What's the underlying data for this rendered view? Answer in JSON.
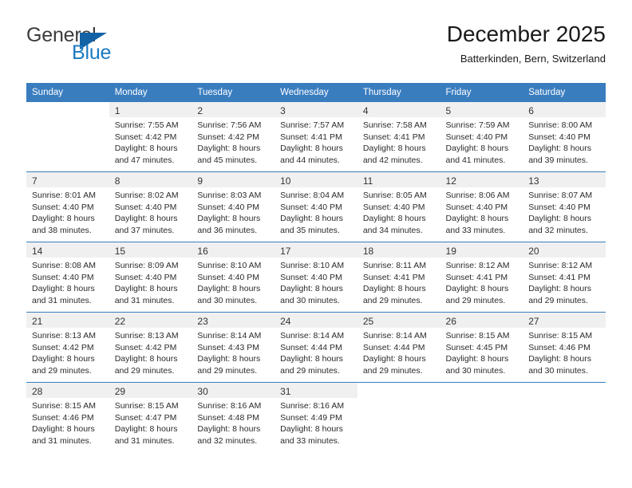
{
  "brand": {
    "word_one": "General",
    "word_two": "Blue",
    "triangle_icon": "triangle-logo-icon",
    "color_dark": "#3c3c3c",
    "color_blue": "#1b7ac2",
    "color_triangle": "#1362a5"
  },
  "header": {
    "title": "December 2025",
    "subtitle": "Batterkinden, Bern, Switzerland"
  },
  "theme": {
    "header_blue": "#3a7dbf",
    "row_band_gray": "#f0f0f0",
    "text": "#2b2b2b"
  },
  "weekday_headers": [
    "Sunday",
    "Monday",
    "Tuesday",
    "Wednesday",
    "Thursday",
    "Friday",
    "Saturday"
  ],
  "weeks": [
    {
      "shaded": true,
      "days": [
        {
          "day": "",
          "lines": []
        },
        {
          "day": "1",
          "lines": [
            "Sunrise: 7:55 AM",
            "Sunset: 4:42 PM",
            "Daylight: 8 hours",
            "and 47 minutes."
          ]
        },
        {
          "day": "2",
          "lines": [
            "Sunrise: 7:56 AM",
            "Sunset: 4:42 PM",
            "Daylight: 8 hours",
            "and 45 minutes."
          ]
        },
        {
          "day": "3",
          "lines": [
            "Sunrise: 7:57 AM",
            "Sunset: 4:41 PM",
            "Daylight: 8 hours",
            "and 44 minutes."
          ]
        },
        {
          "day": "4",
          "lines": [
            "Sunrise: 7:58 AM",
            "Sunset: 4:41 PM",
            "Daylight: 8 hours",
            "and 42 minutes."
          ]
        },
        {
          "day": "5",
          "lines": [
            "Sunrise: 7:59 AM",
            "Sunset: 4:40 PM",
            "Daylight: 8 hours",
            "and 41 minutes."
          ]
        },
        {
          "day": "6",
          "lines": [
            "Sunrise: 8:00 AM",
            "Sunset: 4:40 PM",
            "Daylight: 8 hours",
            "and 39 minutes."
          ]
        }
      ]
    },
    {
      "shaded": true,
      "days": [
        {
          "day": "7",
          "lines": [
            "Sunrise: 8:01 AM",
            "Sunset: 4:40 PM",
            "Daylight: 8 hours",
            "and 38 minutes."
          ]
        },
        {
          "day": "8",
          "lines": [
            "Sunrise: 8:02 AM",
            "Sunset: 4:40 PM",
            "Daylight: 8 hours",
            "and 37 minutes."
          ]
        },
        {
          "day": "9",
          "lines": [
            "Sunrise: 8:03 AM",
            "Sunset: 4:40 PM",
            "Daylight: 8 hours",
            "and 36 minutes."
          ]
        },
        {
          "day": "10",
          "lines": [
            "Sunrise: 8:04 AM",
            "Sunset: 4:40 PM",
            "Daylight: 8 hours",
            "and 35 minutes."
          ]
        },
        {
          "day": "11",
          "lines": [
            "Sunrise: 8:05 AM",
            "Sunset: 4:40 PM",
            "Daylight: 8 hours",
            "and 34 minutes."
          ]
        },
        {
          "day": "12",
          "lines": [
            "Sunrise: 8:06 AM",
            "Sunset: 4:40 PM",
            "Daylight: 8 hours",
            "and 33 minutes."
          ]
        },
        {
          "day": "13",
          "lines": [
            "Sunrise: 8:07 AM",
            "Sunset: 4:40 PM",
            "Daylight: 8 hours",
            "and 32 minutes."
          ]
        }
      ]
    },
    {
      "shaded": true,
      "days": [
        {
          "day": "14",
          "lines": [
            "Sunrise: 8:08 AM",
            "Sunset: 4:40 PM",
            "Daylight: 8 hours",
            "and 31 minutes."
          ]
        },
        {
          "day": "15",
          "lines": [
            "Sunrise: 8:09 AM",
            "Sunset: 4:40 PM",
            "Daylight: 8 hours",
            "and 31 minutes."
          ]
        },
        {
          "day": "16",
          "lines": [
            "Sunrise: 8:10 AM",
            "Sunset: 4:40 PM",
            "Daylight: 8 hours",
            "and 30 minutes."
          ]
        },
        {
          "day": "17",
          "lines": [
            "Sunrise: 8:10 AM",
            "Sunset: 4:40 PM",
            "Daylight: 8 hours",
            "and 30 minutes."
          ]
        },
        {
          "day": "18",
          "lines": [
            "Sunrise: 8:11 AM",
            "Sunset: 4:41 PM",
            "Daylight: 8 hours",
            "and 29 minutes."
          ]
        },
        {
          "day": "19",
          "lines": [
            "Sunrise: 8:12 AM",
            "Sunset: 4:41 PM",
            "Daylight: 8 hours",
            "and 29 minutes."
          ]
        },
        {
          "day": "20",
          "lines": [
            "Sunrise: 8:12 AM",
            "Sunset: 4:41 PM",
            "Daylight: 8 hours",
            "and 29 minutes."
          ]
        }
      ]
    },
    {
      "shaded": true,
      "days": [
        {
          "day": "21",
          "lines": [
            "Sunrise: 8:13 AM",
            "Sunset: 4:42 PM",
            "Daylight: 8 hours",
            "and 29 minutes."
          ]
        },
        {
          "day": "22",
          "lines": [
            "Sunrise: 8:13 AM",
            "Sunset: 4:42 PM",
            "Daylight: 8 hours",
            "and 29 minutes."
          ]
        },
        {
          "day": "23",
          "lines": [
            "Sunrise: 8:14 AM",
            "Sunset: 4:43 PM",
            "Daylight: 8 hours",
            "and 29 minutes."
          ]
        },
        {
          "day": "24",
          "lines": [
            "Sunrise: 8:14 AM",
            "Sunset: 4:44 PM",
            "Daylight: 8 hours",
            "and 29 minutes."
          ]
        },
        {
          "day": "25",
          "lines": [
            "Sunrise: 8:14 AM",
            "Sunset: 4:44 PM",
            "Daylight: 8 hours",
            "and 29 minutes."
          ]
        },
        {
          "day": "26",
          "lines": [
            "Sunrise: 8:15 AM",
            "Sunset: 4:45 PM",
            "Daylight: 8 hours",
            "and 30 minutes."
          ]
        },
        {
          "day": "27",
          "lines": [
            "Sunrise: 8:15 AM",
            "Sunset: 4:46 PM",
            "Daylight: 8 hours",
            "and 30 minutes."
          ]
        }
      ]
    },
    {
      "shaded": true,
      "days": [
        {
          "day": "28",
          "lines": [
            "Sunrise: 8:15 AM",
            "Sunset: 4:46 PM",
            "Daylight: 8 hours",
            "and 31 minutes."
          ]
        },
        {
          "day": "29",
          "lines": [
            "Sunrise: 8:15 AM",
            "Sunset: 4:47 PM",
            "Daylight: 8 hours",
            "and 31 minutes."
          ]
        },
        {
          "day": "30",
          "lines": [
            "Sunrise: 8:16 AM",
            "Sunset: 4:48 PM",
            "Daylight: 8 hours",
            "and 32 minutes."
          ]
        },
        {
          "day": "31",
          "lines": [
            "Sunrise: 8:16 AM",
            "Sunset: 4:49 PM",
            "Daylight: 8 hours",
            "and 33 minutes."
          ]
        },
        {
          "day": "",
          "lines": []
        },
        {
          "day": "",
          "lines": []
        },
        {
          "day": "",
          "lines": []
        }
      ]
    }
  ]
}
